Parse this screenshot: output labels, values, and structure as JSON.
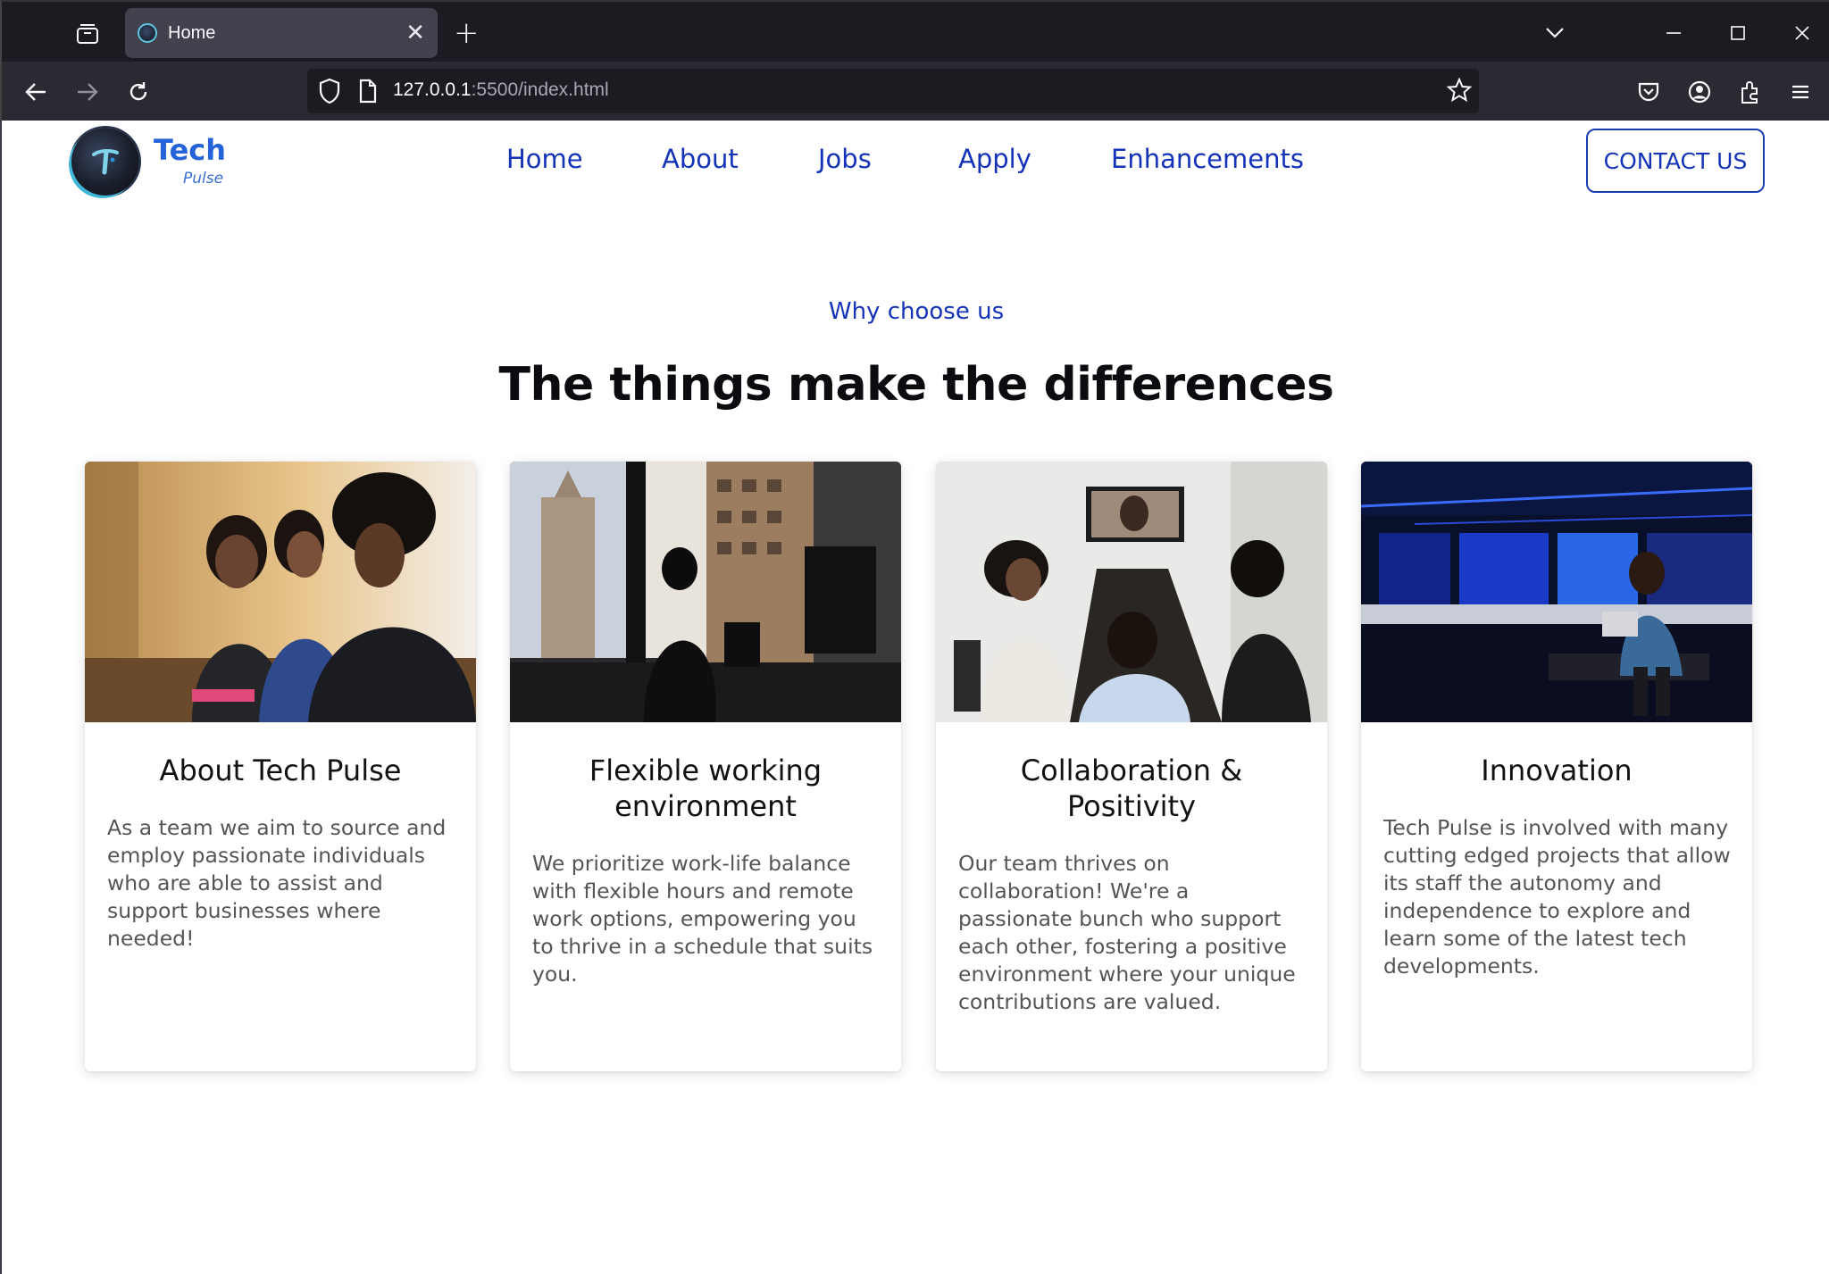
{
  "browser": {
    "tab_title": "Home",
    "url_host": "127.0.0.1",
    "url_path": ":5500/index.html"
  },
  "site": {
    "logo_name": "Tech",
    "logo_sub": "Pulse",
    "nav": [
      "Home",
      "About",
      "Jobs",
      "Apply",
      "Enhancements"
    ],
    "contact_label": "CONTACT US"
  },
  "section": {
    "eyebrow": "Why choose us",
    "headline": "The things make the differences"
  },
  "cards": [
    {
      "title": "About Tech Pulse",
      "text": "As a team we aim to source and employ passionate individuals who are able to assist and support businesses where needed!"
    },
    {
      "title": "Flexible working environment",
      "text": "We prioritize work-life balance with flexible hours and remote work options, empowering you to thrive in a schedule that suits you."
    },
    {
      "title": "Collaboration & Positivity",
      "text": "Our team thrives on collaboration! We're a passionate bunch who support each other, fostering a positive environment where your unique contributions are valued."
    },
    {
      "title": "Innovation",
      "text": "Tech Pulse is involved with many cutting edged projects that allow its staff the autonomy and independence to explore and learn some of the latest tech developments."
    }
  ],
  "colors": {
    "brand_blue": "#1433b8",
    "logo_blue": "#2563d9",
    "chrome_dark": "#1c1b22",
    "chrome_toolbar": "#2b2a33"
  }
}
